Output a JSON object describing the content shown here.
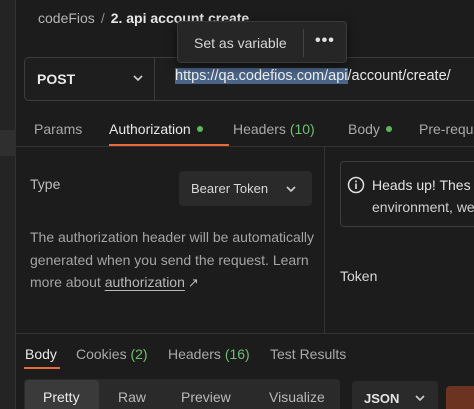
{
  "breadcrumb": {
    "workspace": "codeFios",
    "separator": "/",
    "request": "2. api account create"
  },
  "tooltip": {
    "set_variable": "Set as variable",
    "more": "•••"
  },
  "request": {
    "method": "POST",
    "url_selected": "https://qa.codefios.com/api",
    "url_rest": "/account/create/"
  },
  "request_tabs": [
    {
      "label": "Params"
    },
    {
      "label": "Authorization",
      "status_dot": "#5cb85c"
    },
    {
      "label": "Headers",
      "count": "(10)"
    },
    {
      "label": "Body",
      "status_dot": "#5cb85c"
    },
    {
      "label": "Pre-requ"
    }
  ],
  "auth": {
    "type_label": "Type",
    "type_value": "Bearer Token",
    "description_pre": "The authorization header will be automatically generated when you send the request. Learn more about",
    "description_link": "authorization",
    "link_arrow": "↗",
    "info_line1": "Heads up! Thes",
    "info_line2": "environment, we",
    "token_label": "Token"
  },
  "response_tabs": [
    {
      "label": "Body"
    },
    {
      "label": "Cookies",
      "count": "(2)"
    },
    {
      "label": "Headers",
      "count": "(16)"
    },
    {
      "label": "Test Results"
    }
  ],
  "response_view": {
    "options": [
      "Pretty",
      "Raw",
      "Preview",
      "Visualize"
    ],
    "selected": "Pretty",
    "format": "JSON"
  },
  "colors": {
    "accent": "#e66a3a",
    "success": "#5cb85c",
    "selection": "#4a6587"
  }
}
